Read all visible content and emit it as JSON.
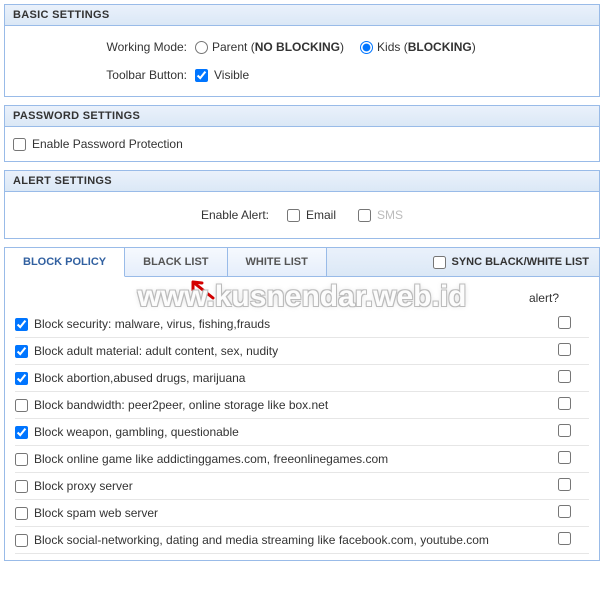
{
  "basic": {
    "title": "BASIC SETTINGS",
    "working_mode_label": "Working Mode:",
    "parent_label_pre": "Parent (",
    "parent_label_bold": "NO BLOCKING",
    "parent_label_post": ")",
    "kids_label_pre": "Kids (",
    "kids_label_bold": "BLOCKING",
    "kids_label_post": ")",
    "parent_checked": false,
    "kids_checked": true,
    "toolbar_label": "Toolbar Button:",
    "visible_label": "Visible",
    "visible_checked": true
  },
  "password": {
    "title": "PASSWORD SETTINGS",
    "enable_label": "Enable Password Protection",
    "enable_checked": false
  },
  "alert": {
    "title": "ALERT SETTINGS",
    "enable_label": "Enable Alert:",
    "email_label": "Email",
    "email_checked": false,
    "sms_label": "SMS",
    "sms_checked": false
  },
  "tabs": {
    "items": [
      {
        "label": "BLOCK POLICY",
        "active": true
      },
      {
        "label": "BLACK LIST",
        "active": false
      },
      {
        "label": "WHITE LIST",
        "active": false
      }
    ],
    "sync_label": "SYNC BLACK/WHITE LIST",
    "sync_checked": false
  },
  "policy": {
    "alert_header": "alert?",
    "rows": [
      {
        "label": "Block security: malware, virus, fishing,frauds",
        "checked": true,
        "alert": false
      },
      {
        "label": "Block adult material: adult content, sex, nudity",
        "checked": true,
        "alert": false
      },
      {
        "label": "Block abortion,abused drugs, marijuana",
        "checked": true,
        "alert": false
      },
      {
        "label": "Block bandwidth: peer2peer, online storage like box.net",
        "checked": false,
        "alert": false
      },
      {
        "label": "Block weapon, gambling, questionable",
        "checked": true,
        "alert": false
      },
      {
        "label": "Block online game like addictinggames.com, freeonlinegames.com",
        "checked": false,
        "alert": false
      },
      {
        "label": "Block proxy server",
        "checked": false,
        "alert": false
      },
      {
        "label": "Block spam web server",
        "checked": false,
        "alert": false
      },
      {
        "label": "Block social-networking, dating and media streaming like facebook.com, youtube.com",
        "checked": false,
        "alert": false
      }
    ]
  },
  "watermark": "www.kusnendar.web.id"
}
